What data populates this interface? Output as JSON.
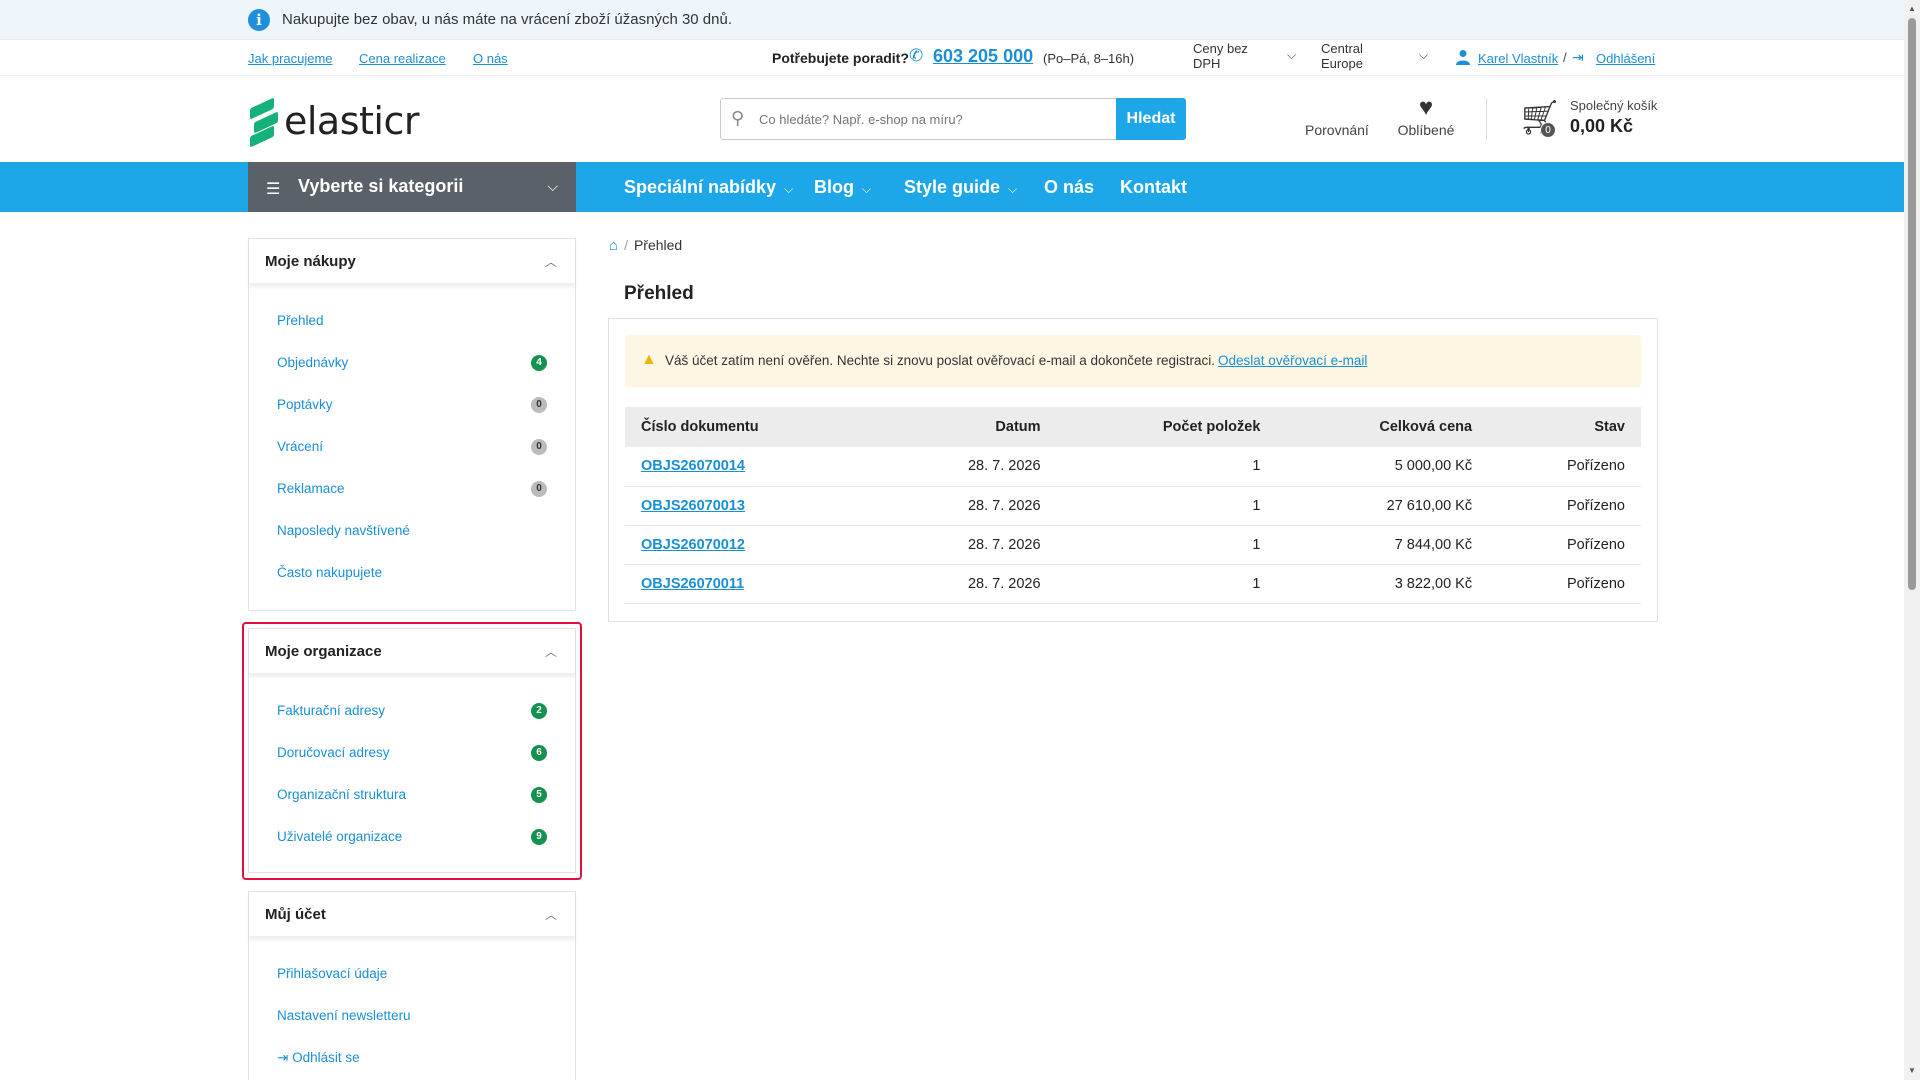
{
  "infobar": {
    "text": "Nakupujte bez obav, u nás máte na vrácení zboží úžasných 30 dnů.",
    "icon": "info-icon"
  },
  "util": {
    "links": [
      "Jak pracujeme",
      "Cena realizace",
      "O nás"
    ],
    "help_label": "Potřebujete poradit?",
    "phone": "603 205 000",
    "hours": "(Po–Pá, 8–16h)",
    "price_mode_line1": "Ceny bez",
    "price_mode_line2": "DPH",
    "region_line1": "Central",
    "region_line2": "Europe",
    "user_name": "Karel Vlastník",
    "slash": "/",
    "logout": "Odhlášení"
  },
  "header": {
    "logo_text": "elasticr",
    "search_placeholder": "Co hledáte? Např. e-shop na míru?",
    "search_button": "Hledat",
    "compare_label": "Porovnání",
    "favorites_label": "Oblíbené",
    "cart_label": "Společný košík",
    "cart_amount": "0,00 Kč",
    "cart_count": "0"
  },
  "nav": {
    "category_button": "Vyberte si kategorii",
    "items": [
      "Speciální nabídky",
      "Blog",
      "Style guide",
      "O nás",
      "Kontakt"
    ]
  },
  "sidebar": {
    "purchases": {
      "title": "Moje nákupy",
      "items": [
        {
          "label": "Přehled",
          "badge": ""
        },
        {
          "label": "Objednávky",
          "badge": "4"
        },
        {
          "label": "Poptávky",
          "badge": "0"
        },
        {
          "label": "Vrácení",
          "badge": "0"
        },
        {
          "label": "Reklamace",
          "badge": "0"
        },
        {
          "label": "Naposledy navštívené",
          "badge": ""
        },
        {
          "label": "Často nakupujete",
          "badge": ""
        }
      ]
    },
    "organization": {
      "title": "Moje organizace",
      "items": [
        {
          "label": "Fakturační adresy",
          "badge": "2"
        },
        {
          "label": "Doručovací adresy",
          "badge": "6"
        },
        {
          "label": "Organizační struktura",
          "badge": "5"
        },
        {
          "label": "Uživatelé organizace",
          "badge": "9"
        }
      ]
    },
    "account": {
      "title": "Můj účet",
      "items": [
        {
          "label": "Přihlašovací údaje"
        },
        {
          "label": "Nastavení newsletteru"
        },
        {
          "label": "Odhlásit se"
        }
      ]
    }
  },
  "main": {
    "breadcrumb_current": "Přehled",
    "title": "Přehled",
    "alert_text": "Váš účet zatím není ověřen. Nechte si znovu poslat ověřovací e-mail a dokončete registraci.",
    "alert_link": "Odeslat ověřovací e-mail",
    "table": {
      "headers": [
        "Číslo dokumentu",
        "Datum",
        "Počet položek",
        "Celková cena",
        "Stav"
      ],
      "rows": [
        [
          "OBJS26070014",
          "28. 7. 2026",
          "1",
          "5 000,00 Kč",
          "Pořízeno"
        ],
        [
          "OBJS26070013",
          "28. 7. 2026",
          "1",
          "27 610,00 Kč",
          "Pořízeno"
        ],
        [
          "OBJS26070012",
          "28. 7. 2026",
          "1",
          "7 844,00 Kč",
          "Pořízeno"
        ],
        [
          "OBJS26070011",
          "28. 7. 2026",
          "1",
          "3 822,00 Kč",
          "Pořízeno"
        ]
      ]
    }
  },
  "colors": {
    "accent": "#1ea7e8",
    "nav_dark": "#5a6169",
    "badge_green": "#13924f",
    "highlight": "#e0123d"
  }
}
